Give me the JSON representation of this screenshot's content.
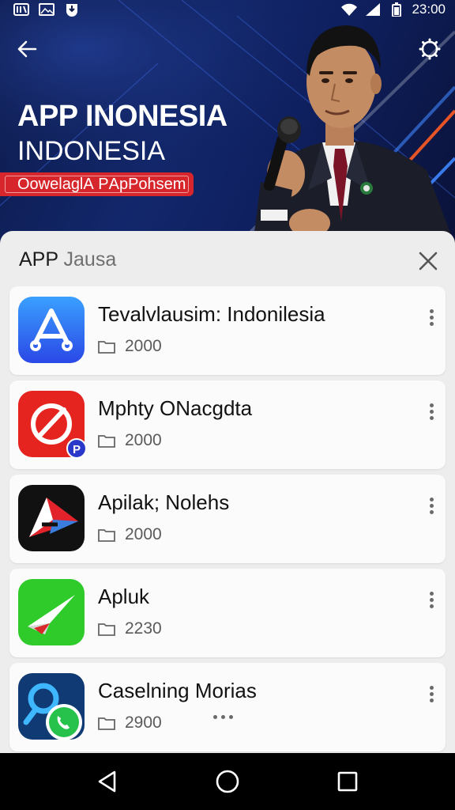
{
  "status_bar": {
    "time": "23:00",
    "left_icons": [
      "book-icon",
      "image-icon",
      "shield-download-icon"
    ],
    "right_icons": [
      "wifi-icon",
      "signal-icon",
      "battery-icon"
    ]
  },
  "hero": {
    "title": "APP INONESIA",
    "subtitle": "INDONESIA",
    "tag": "OowelaglА РApPohsem",
    "accent_color": "#d7262b"
  },
  "sheet": {
    "title_main": "APP",
    "title_muted": "Jausa"
  },
  "apps": [
    {
      "name": "Tevalvlausim: Indonilesia",
      "meta": "2000",
      "icon": "app-store-icon"
    },
    {
      "name": "Mphty ONacgdta",
      "meta": "2000",
      "icon": "red-slash-app-icon",
      "badge": "P"
    },
    {
      "name": "Apilak; Nolehs",
      "meta": "2000",
      "icon": "red-arrow-app-icon"
    },
    {
      "name": "Apluk",
      "meta": "2230",
      "icon": "paper-plane-app-icon"
    },
    {
      "name": "Caselning Morias",
      "meta": "2900",
      "icon": "search-whatsapp-app-icon"
    }
  ],
  "nav": [
    "back-icon",
    "home-icon",
    "recents-icon"
  ]
}
